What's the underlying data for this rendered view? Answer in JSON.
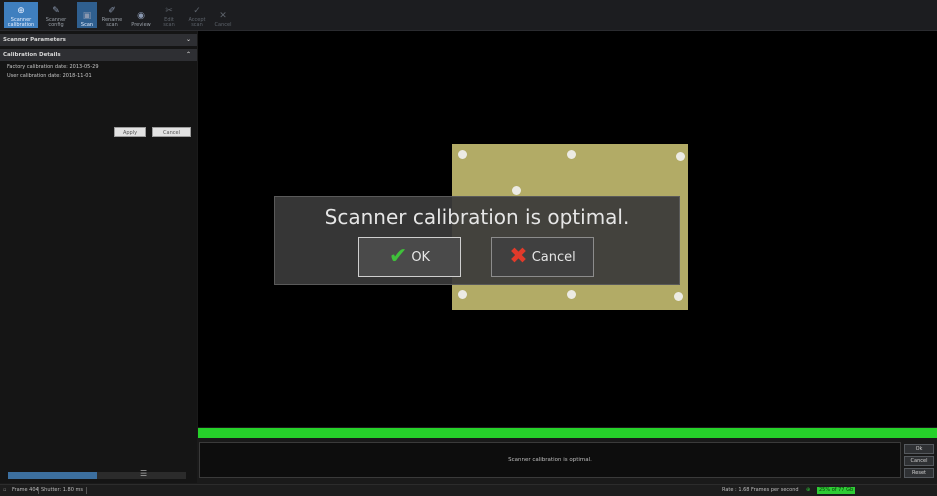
{
  "toolbar": {
    "buttons": [
      {
        "label": "Scanner calibration",
        "icon": "crosshair-icon"
      },
      {
        "label": "Scanner config",
        "icon": "wrench-icon"
      },
      {
        "label": "Scan",
        "icon": "scan-icon"
      },
      {
        "label": "Rename scan",
        "icon": "pencil-icon"
      },
      {
        "label": "Preview",
        "icon": "eye-icon"
      },
      {
        "label": "Edit scan",
        "icon": "edit-icon"
      },
      {
        "label": "Accept scan",
        "icon": "accept-icon"
      },
      {
        "label": "Cancel",
        "icon": "cancel-icon"
      }
    ]
  },
  "left_panel": {
    "scanner_parameters": "Scanner Parameters",
    "calibration_details": "Calibration Details",
    "factory_calibration": "Factory calibration date: 2013-05-29",
    "user_calibration": "User calibration date: 2018-11-01",
    "apply": "Apply",
    "cancel": "Cancel",
    "progress": 0.5
  },
  "dialog": {
    "message": "Scanner calibration is optimal.",
    "ok": "OK",
    "cancel": "Cancel"
  },
  "message_box": {
    "text": "Scanner calibration is optimal."
  },
  "side_buttons": {
    "ok": "Ok",
    "cancel": "Cancel",
    "reset": "Reset"
  },
  "status_bar": {
    "frame": "Frame 404",
    "shutter": "Shutter: 1.80 ms",
    "rate": "Rate : 1.68 Frames per second",
    "storage": "25% of 77 Gb"
  },
  "colors": {
    "accent": "#3f7fbf",
    "progress_green": "#26d12a",
    "board": "#b2ab66"
  }
}
